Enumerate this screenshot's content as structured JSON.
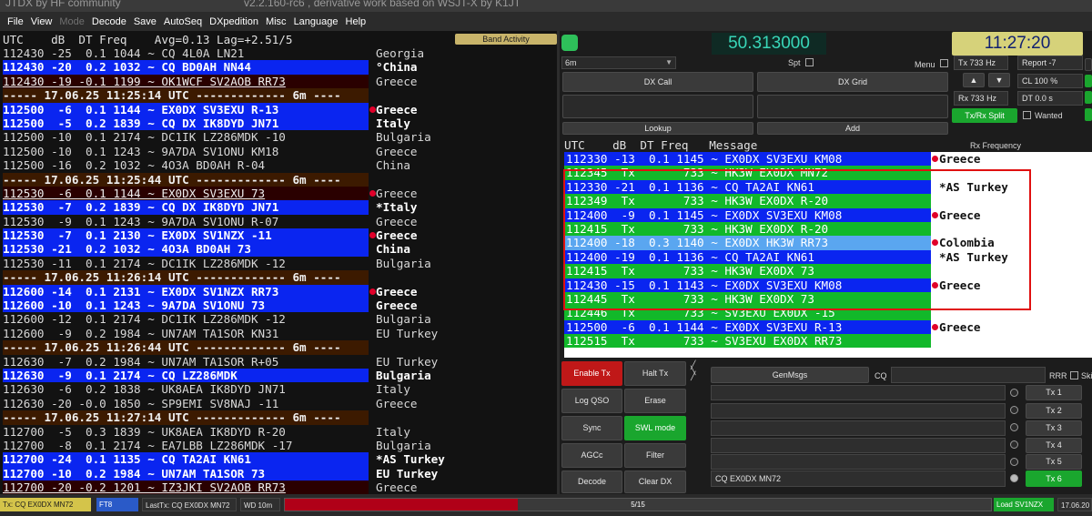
{
  "titlebar": {
    "app": "JTDX  by HF community",
    "subtitle": "v2.2.160-rc6 , derivative work based on WSJT-X by K1JT"
  },
  "menu": [
    "File",
    "View",
    "Mode",
    "Decode",
    "Save",
    "AutoSeq",
    "DXpedition",
    "Misc",
    "Language",
    "Help"
  ],
  "band_activity": {
    "header": "UTC    dB  DT Freq    Avg=0.13 Lag=+2.51/5",
    "label": "Band Activity",
    "rows": [
      {
        "type": "plain",
        "msg": "112430 -25  0.1 1044 ~ CQ 4L0A LN21",
        "country": "Georgia",
        "dot": false
      },
      {
        "type": "cq",
        "msg": "112430 -20  0.2 1032 ~ CQ BD0AH NN44",
        "country": "°China",
        "dot": false
      },
      {
        "type": "mine",
        "msg": "112430 -19 -0.1 1199 ~ OK1WCF SV2AOB RR73",
        "country": "Greece",
        "dot": false
      },
      {
        "type": "sep",
        "msg": "----- 17.06.25 11:25:14 UTC ------------- 6m ----",
        "country": "",
        "dot": false
      },
      {
        "type": "cq",
        "msg": "112500  -6  0.1 1144 ~ EX0DX SV3EXU R-13",
        "country": "Greece",
        "dot": true
      },
      {
        "type": "cq",
        "msg": "112500  -5  0.2 1839 ~ CQ DX IK8DYD JN71",
        "country": "Italy",
        "dot": false
      },
      {
        "type": "plain",
        "msg": "112500 -10  0.1 2174 ~ DC1IK LZ286MDK -10",
        "country": "Bulgaria",
        "dot": false
      },
      {
        "type": "plain",
        "msg": "112500 -10  0.1 1243 ~ 9A7DA SV1ONU KM18",
        "country": "Greece",
        "dot": false
      },
      {
        "type": "plain",
        "msg": "112500 -16  0.2 1032 ~ 4O3A BD0AH R-04",
        "country": "China",
        "dot": false
      },
      {
        "type": "sep",
        "msg": "----- 17.06.25 11:25:44 UTC ------------- 6m ----",
        "country": "",
        "dot": false
      },
      {
        "type": "mine",
        "msg": "112530  -6  0.1 1144 ~ EX0DX SV3EXU 73",
        "country": "Greece",
        "dot": true
      },
      {
        "type": "cq",
        "msg": "112530  -7  0.2 1839 ~ CQ DX IK8DYD JN71",
        "country": "*Italy",
        "dot": false
      },
      {
        "type": "plain",
        "msg": "112530  -9  0.1 1243 ~ 9A7DA SV1ONU R-07",
        "country": "Greece",
        "dot": false
      },
      {
        "type": "cq",
        "msg": "112530  -7  0.1 2130 ~ EX0DX SV1NZX -11",
        "country": "Greece",
        "dot": true
      },
      {
        "type": "cq",
        "msg": "112530 -21  0.2 1032 ~ 4O3A BD0AH 73",
        "country": "China",
        "dot": false
      },
      {
        "type": "plain",
        "msg": "112530 -11  0.1 2174 ~ DC1IK LZ286MDK -12",
        "country": "Bulgaria",
        "dot": false
      },
      {
        "type": "sep",
        "msg": "----- 17.06.25 11:26:14 UTC ------------- 6m ----",
        "country": "",
        "dot": false
      },
      {
        "type": "cq",
        "msg": "112600 -14  0.1 2131 ~ EX0DX SV1NZX RR73",
        "country": "Greece",
        "dot": true
      },
      {
        "type": "cq",
        "msg": "112600 -10  0.1 1243 ~ 9A7DA SV1ONU 73",
        "country": "Greece",
        "dot": false
      },
      {
        "type": "plain",
        "msg": "112600 -12  0.1 2174 ~ DC1IK LZ286MDK -12",
        "country": "Bulgaria",
        "dot": false
      },
      {
        "type": "plain",
        "msg": "112600  -9  0.2 1984 ~ UN7AM TA1SOR KN31",
        "country": "EU Turkey",
        "dot": false
      },
      {
        "type": "sep",
        "msg": "----- 17.06.25 11:26:44 UTC ------------- 6m ----",
        "country": "",
        "dot": false
      },
      {
        "type": "plain",
        "msg": "112630  -7  0.2 1984 ~ UN7AM TA1SOR R+05",
        "country": "EU Turkey",
        "dot": false
      },
      {
        "type": "cq",
        "msg": "112630  -9  0.1 2174 ~ CQ LZ286MDK",
        "country": "Bulgaria",
        "dot": false
      },
      {
        "type": "plain",
        "msg": "112630  -6  0.2 1838 ~ UK8AEA IK8DYD JN71",
        "country": "Italy",
        "dot": false
      },
      {
        "type": "plain",
        "msg": "112630 -20 -0.0 1850 ~ SP9EMI SV8NAJ -11",
        "country": "Greece",
        "dot": false
      },
      {
        "type": "sep",
        "msg": "----- 17.06.25 11:27:14 UTC ------------- 6m ----",
        "country": "",
        "dot": false
      },
      {
        "type": "plain",
        "msg": "112700  -5  0.3 1839 ~ UK8AEA IK8DYD R-20",
        "country": "Italy",
        "dot": false
      },
      {
        "type": "plain",
        "msg": "112700  -8  0.1 2174 ~ EA7LBB LZ286MDK -17",
        "country": "Bulgaria",
        "dot": false
      },
      {
        "type": "cq",
        "msg": "112700 -24  0.1 1135 ~ CQ TA2AI KN61",
        "country": "*AS Turkey",
        "dot": false
      },
      {
        "type": "cq",
        "msg": "112700 -10  0.2 1984 ~ UN7AM TA1SOR 73",
        "country": "EU Turkey",
        "dot": false
      },
      {
        "type": "mine",
        "msg": "112700 -20 -0.2 1201 ~ IZ3JKI SV2AOB RR73",
        "country": "Greece",
        "dot": false
      }
    ]
  },
  "controls": {
    "frequency": "50.313000",
    "clock": "11:27:20",
    "band": "6m",
    "spt_label": "Spt",
    "menu_label": "Menu",
    "tx_label": "Tx",
    "tx_value": "733",
    "tx_unit": "Hz",
    "rx_label": "Rx",
    "rx_value": "733",
    "rx_unit": "Hz",
    "report_label": "Report -7",
    "cl_label": "CL  100 %",
    "dt_label": "DT  0.0 s",
    "txrx_split": "Tx/Rx Split",
    "wanted": "Wanted",
    "dx_call": "DX Call",
    "dx_grid": "DX Grid",
    "lookup": "Lookup",
    "add": "Add",
    "rx_frequency": "Rx Frequency",
    "up_arrow": "▲",
    "down_arrow": "▼"
  },
  "rx_panel": {
    "header": "UTC    dB  DT Freq   Message",
    "rows": [
      {
        "type": "cq",
        "msg": "112330 -13  0.1 1145 ~ EX0DX SV3EXU KM08",
        "country": "Greece",
        "dot": true
      },
      {
        "type": "tx",
        "msg": "112345  Tx       733 ~ HK3W EX0DX MN72",
        "country": "",
        "dot": false
      },
      {
        "type": "cq",
        "msg": "112330 -21  0.1 1136 ~ CQ TA2AI KN61",
        "country": "*AS Turkey",
        "dot": false
      },
      {
        "type": "tx",
        "msg": "112349  Tx       733 ~ HK3W EX0DX R-20",
        "country": "",
        "dot": false
      },
      {
        "type": "cq",
        "msg": "112400  -9  0.1 1145 ~ EX0DX SV3EXU KM08",
        "country": "Greece",
        "dot": true
      },
      {
        "type": "tx",
        "msg": "112415  Tx       733 ~ HK3W EX0DX R-20",
        "country": "",
        "dot": false
      },
      {
        "type": "lb",
        "msg": "112400 -18  0.3 1140 ~ EX0DX HK3W RR73",
        "country": "Colombia",
        "dot": true
      },
      {
        "type": "cq",
        "msg": "112400 -19  0.1 1136 ~ CQ TA2AI KN61",
        "country": "*AS Turkey",
        "dot": false
      },
      {
        "type": "tx",
        "msg": "112415  Tx       733 ~ HK3W EX0DX 73",
        "country": "",
        "dot": false
      },
      {
        "type": "cq",
        "msg": "112430 -15  0.1 1143 ~ EX0DX SV3EXU KM08",
        "country": "Greece",
        "dot": true
      },
      {
        "type": "tx",
        "msg": "112445  Tx       733 ~ HK3W EX0DX 73",
        "country": "",
        "dot": false
      },
      {
        "type": "tx",
        "msg": "112446  Tx       733 ~ SV3EXU EX0DX -15",
        "country": "",
        "dot": false
      },
      {
        "type": "cq",
        "msg": "112500  -6  0.1 1144 ~ EX0DX SV3EXU R-13",
        "country": "Greece",
        "dot": true
      },
      {
        "type": "tx",
        "msg": "112515  Tx       733 ~ SV3EXU EX0DX RR73",
        "country": "",
        "dot": false
      }
    ]
  },
  "buttons": {
    "enable_tx": "Enable Tx",
    "halt_tx": "Halt Tx",
    "log_qso": "Log QSO",
    "erase": "Erase",
    "sync": "Sync",
    "swl_mode": "SWL mode",
    "agcc": "AGCc",
    "filter": "Filter",
    "decode": "Decode",
    "clear_dx": "Clear DX",
    "genmsgs": "GenMsgs",
    "cq_label": "CQ",
    "rrr_label": "RRR",
    "skip_label": "Skip",
    "tx_buttons": [
      "Tx 1",
      "Tx 2",
      "Tx 3",
      "Tx 4",
      "Tx 5",
      "Tx 6"
    ],
    "msg6": "CQ EX0DX MN72"
  },
  "status": {
    "tx_msg": "Tx: CQ EX0DX MN72",
    "mode": "FT8",
    "last_tx": "LastTx: CQ EX0DX MN72",
    "wd": "WD 10m",
    "progress": "5/15",
    "progress_fraction": 0.33,
    "load": "Load SV1NZX",
    "date": "17.06.20"
  },
  "colors": {
    "cq_row": "#0a25f0",
    "tx_row": "#12b82a",
    "separator": "#3c1a00",
    "highlight_box": "#e01010",
    "progress": "#b00018"
  }
}
